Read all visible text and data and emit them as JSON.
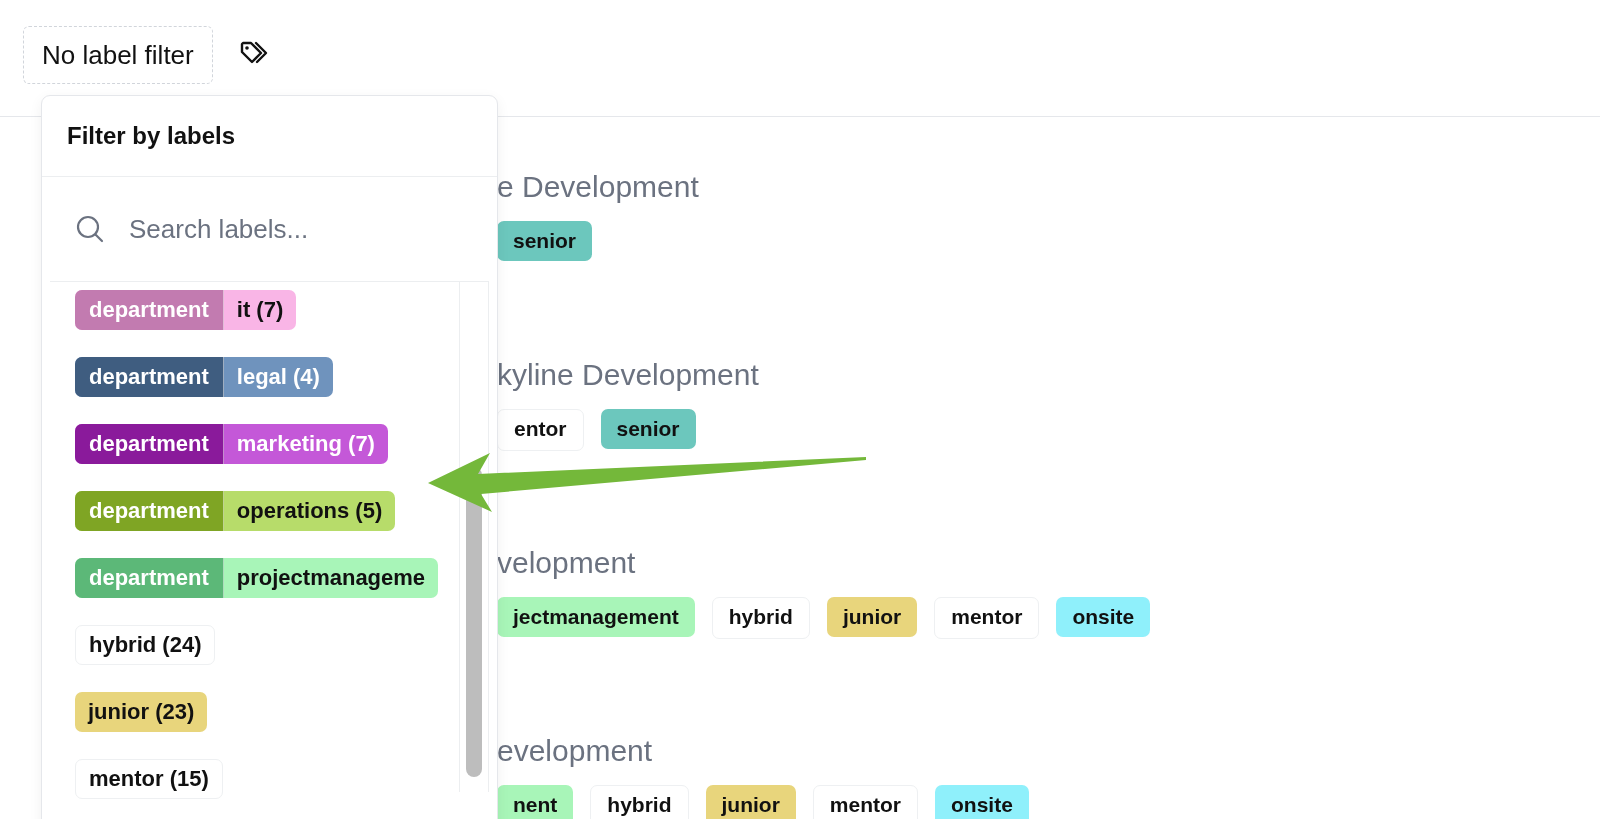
{
  "filter_button": {
    "label": "No label filter"
  },
  "popover": {
    "title": "Filter by labels",
    "search": {
      "placeholder": "Search labels..."
    },
    "labels": [
      {
        "scope": {
          "text": "department",
          "color": "#c27bb0"
        },
        "value": "it (7)",
        "color": "#f9b5e6"
      },
      {
        "scope": {
          "text": "department",
          "color": "#3f5d80"
        },
        "value": "legal (4)",
        "color": "#6f93bd"
      },
      {
        "scope": {
          "text": "department",
          "color": "#8a1a9b"
        },
        "value": "marketing (7)",
        "color": "#c458d8"
      },
      {
        "scope": {
          "text": "department",
          "color": "#7fa524"
        },
        "value": "operations (5)",
        "color": "#b7dc6a"
      },
      {
        "scope": {
          "text": "department",
          "color": "#5cb878"
        },
        "value": "projectmanageme",
        "color": "#a8f5b8"
      },
      {
        "value": "hybrid (24)",
        "color": "#ffffff"
      },
      {
        "value": "junior (23)",
        "color": "#e8d57c"
      },
      {
        "value": "mentor (15)",
        "color": "#ffffff"
      }
    ]
  },
  "projects": [
    {
      "title": "e Development",
      "tags": [
        {
          "text": "senior",
          "color": "#6cc7bd"
        }
      ]
    },
    {
      "title": "kyline Development",
      "tags": [
        {
          "text": "entor",
          "color": "#ffffff"
        },
        {
          "text": "senior",
          "color": "#6cc7bd"
        }
      ]
    },
    {
      "title": "velopment",
      "tags": [
        {
          "text": "jectmanagement",
          "color": "#a8f5b8"
        },
        {
          "text": "hybrid",
          "color": "#ffffff"
        },
        {
          "text": "junior",
          "color": "#e8d57c"
        },
        {
          "text": "mentor",
          "color": "#ffffff"
        },
        {
          "text": "onsite",
          "color": "#8ff0fb"
        }
      ]
    },
    {
      "title": "evelopment",
      "tags": [
        {
          "text": "nent",
          "color": "#a8f5b8"
        },
        {
          "text": "hybrid",
          "color": "#ffffff"
        },
        {
          "text": "junior",
          "color": "#e8d57c"
        },
        {
          "text": "mentor",
          "color": "#ffffff"
        },
        {
          "text": "onsite",
          "color": "#8ff0fb"
        }
      ]
    }
  ]
}
